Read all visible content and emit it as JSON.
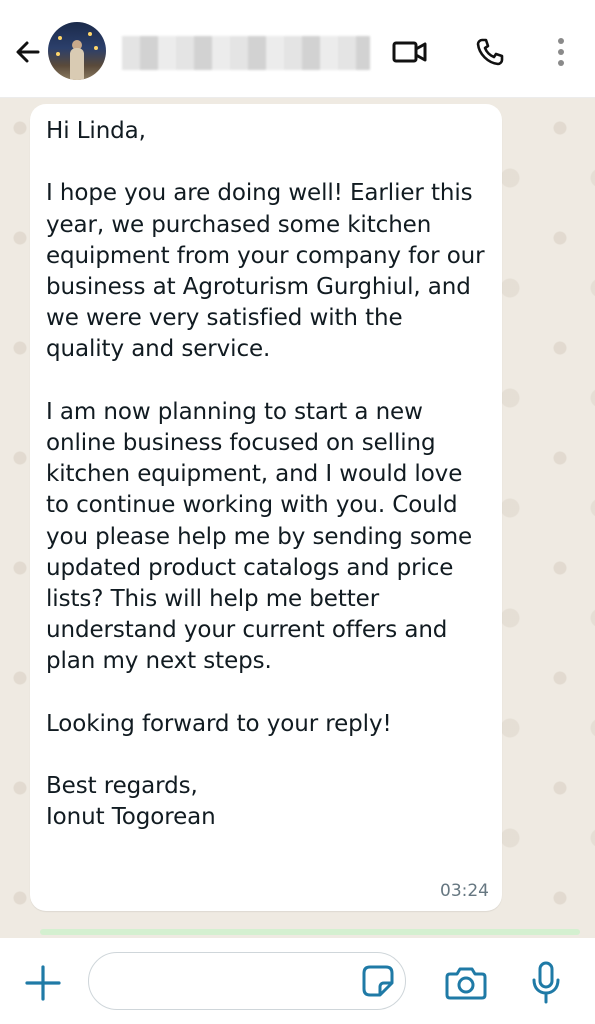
{
  "header": {
    "back_icon": "back-arrow-icon",
    "contact_name": "",
    "icons": [
      "video-call-icon",
      "voice-call-icon",
      "more-options-icon"
    ]
  },
  "message": {
    "paragraphs": [
      "Hi Linda,",
      "I hope you are doing well! Earlier this year, we purchased some kitchen equipment from your company for our business at Agroturism Gurghiul, and we were very satisfied with the quality and service.",
      "I am now planning to start a new online business focused on selling kitchen equipment, and I would love to continue working with you. Could you please help me by sending some updated product catalogs and price lists? This will help me better understand your current offers and plan my next steps.",
      "Looking forward to your reply!",
      "Best regards,",
      "Ionut Togorean"
    ],
    "time": "03:24"
  },
  "composer": {
    "placeholder": "",
    "icons": [
      "plus-icon",
      "sticker-icon",
      "camera-icon",
      "microphone-icon"
    ]
  },
  "colors": {
    "accent": "#1f7aa6",
    "chat_background": "#efeae2",
    "bubble": "#ffffff",
    "text": "#111b21",
    "timestamp": "#667781"
  }
}
